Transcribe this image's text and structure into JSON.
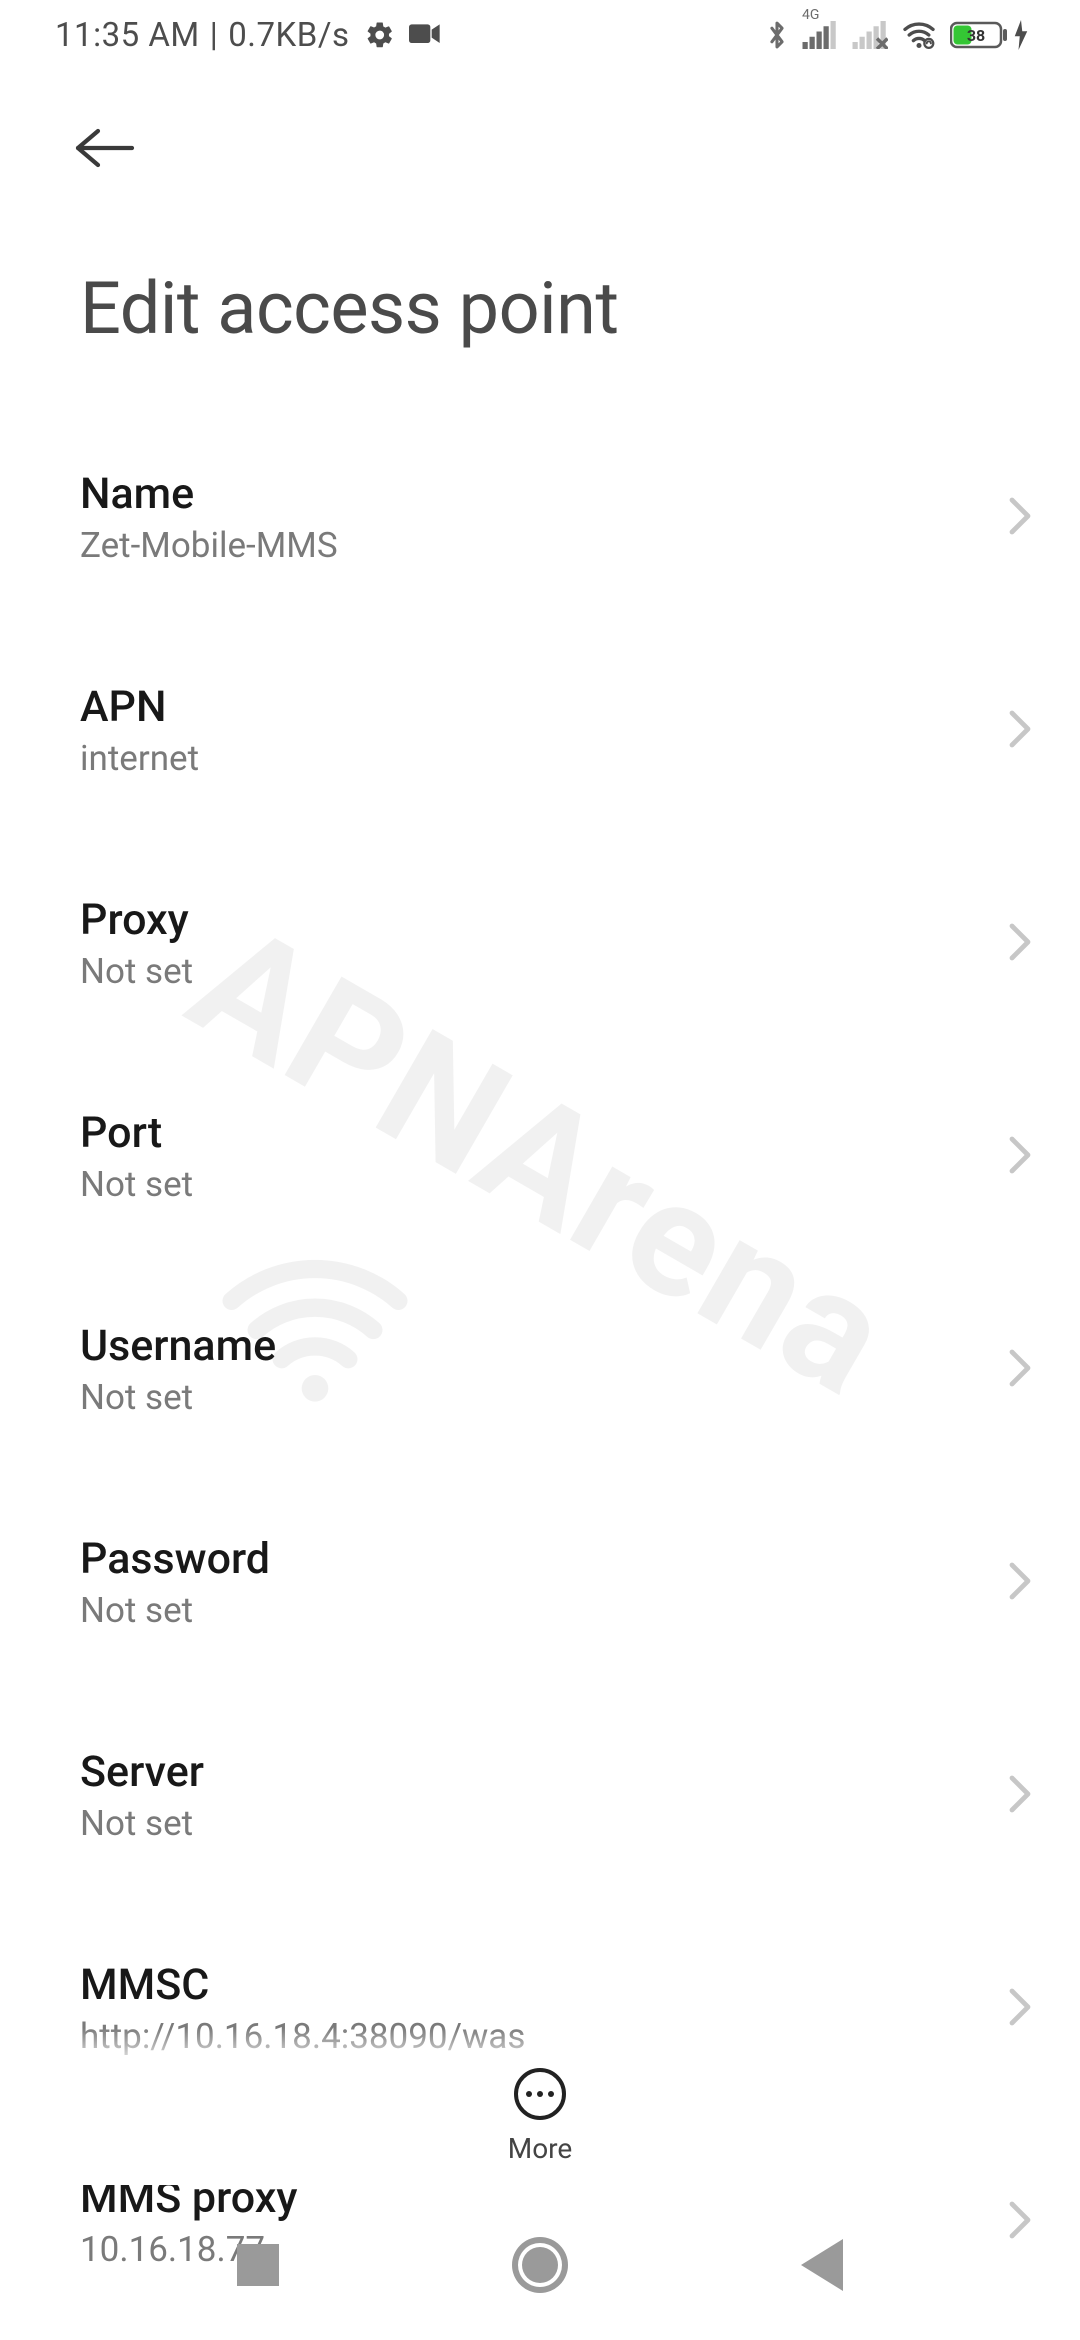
{
  "status": {
    "time": "11:35 AM",
    "net_speed": "0.7KB/s",
    "network_label": "4G",
    "battery_percent": "38"
  },
  "header": {
    "title": "Edit access point"
  },
  "settings": [
    {
      "label": "Name",
      "value": "Zet-Mobile-MMS"
    },
    {
      "label": "APN",
      "value": "internet"
    },
    {
      "label": "Proxy",
      "value": "Not set"
    },
    {
      "label": "Port",
      "value": "Not set"
    },
    {
      "label": "Username",
      "value": "Not set"
    },
    {
      "label": "Password",
      "value": "Not set"
    },
    {
      "label": "Server",
      "value": "Not set"
    },
    {
      "label": "MMSC",
      "value": "http://10.16.18.4:38090/was"
    },
    {
      "label": "MMS proxy",
      "value": "10.16.18.77"
    }
  ],
  "footer": {
    "more_label": "More"
  },
  "watermark": {
    "text": "APNArena"
  }
}
